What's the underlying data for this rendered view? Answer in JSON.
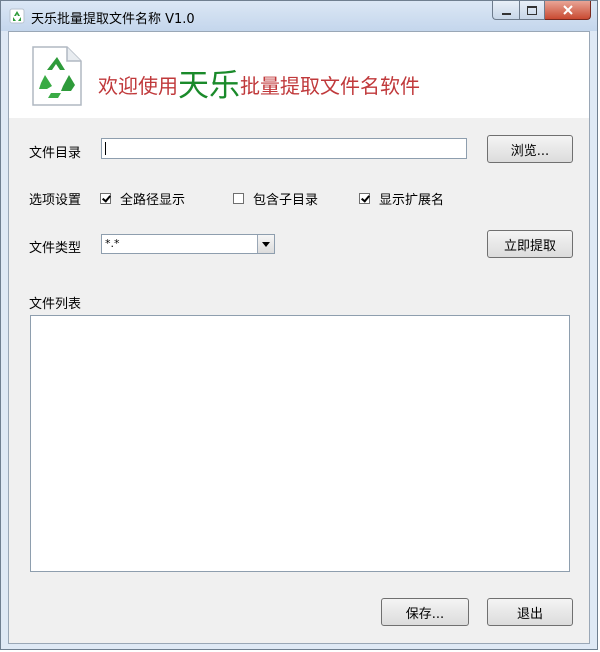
{
  "window": {
    "title": "天乐批量提取文件名称 V1.0"
  },
  "banner": {
    "prefix": "欢迎使用",
    "brand": "天乐",
    "suffix": "批量提取文件名软件"
  },
  "form": {
    "dir_label": "文件目录",
    "dir_value": "",
    "browse_label": "浏览...",
    "options_label": "选项设置",
    "options": [
      {
        "label": "全路径显示",
        "checked": true
      },
      {
        "label": "包含子目录",
        "checked": false
      },
      {
        "label": "显示扩展名",
        "checked": true
      }
    ],
    "type_label": "文件类型",
    "type_value": "*.*",
    "extract_label": "立即提取",
    "list_label": "文件列表"
  },
  "footer": {
    "save_label": "保存...",
    "exit_label": "退出"
  },
  "colors": {
    "welcome": "#c0393b",
    "brand": "#1a8a2a",
    "close": "#c94a32"
  }
}
